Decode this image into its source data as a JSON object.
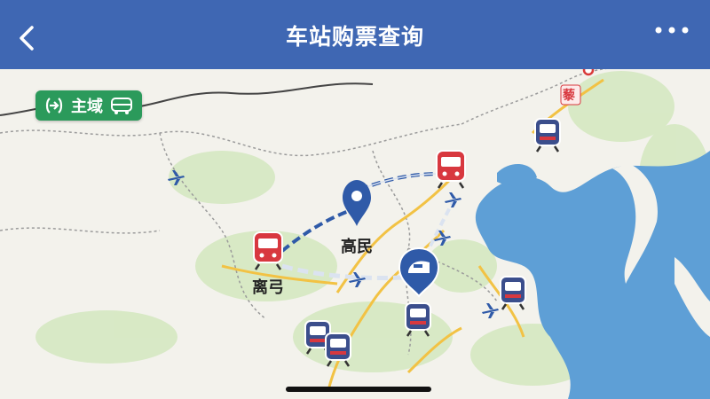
{
  "header": {
    "title": "车站购票查询"
  },
  "badge": {
    "label": "主域"
  },
  "map": {
    "cities": [
      {
        "id": "city-a",
        "label": "离弓"
      },
      {
        "id": "city-b",
        "label": "高民"
      }
    ],
    "corner_label": "藜"
  },
  "colors": {
    "header": "#3f67b3",
    "badge": "#2b9a5b",
    "route_main": "#2f5aa8",
    "route_dashed": "#dbe3f0",
    "water": "#5e9fd6",
    "land": "#f3f2ec",
    "highway": "#f2c244"
  },
  "icons": [
    "back-icon",
    "more-icon",
    "train-icon",
    "location-pin-icon",
    "airplane-icon",
    "bus-icon",
    "arrow-right-icon"
  ]
}
